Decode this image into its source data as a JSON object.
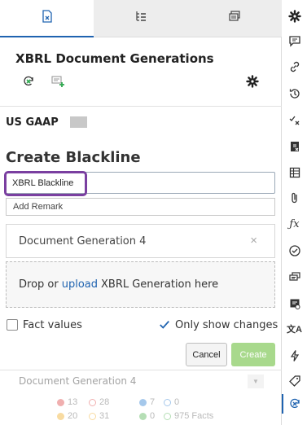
{
  "panel": {
    "tabs": [
      {
        "icon": "document-formula-icon",
        "active": true
      },
      {
        "icon": "tree-list-icon",
        "active": false
      },
      {
        "icon": "stacked-pages-icon",
        "active": false
      }
    ],
    "title": "XBRL Document Generations",
    "gaap_label": "US GAAP",
    "create_title": "Create Blackline",
    "name_input_value": "XBRL Blackline",
    "remark_placeholder": "Add Remark",
    "selected_generation": "Document Generation 4",
    "remove_symbol": "×",
    "drop": {
      "before": "Drop or",
      "link": "upload",
      "after": "XBRL Generation here"
    },
    "options": {
      "fact_values_label": "Fact values",
      "fact_values_checked": false,
      "only_changes_label": "Only show changes",
      "only_changes_checked": true
    },
    "buttons": {
      "cancel": "Cancel",
      "create": "Create"
    },
    "previous": {
      "name": "Document Generation 4",
      "stats": {
        "red_filled": "13",
        "red_outline": "28",
        "blue_filled": "7",
        "blue_outline": "0",
        "yellow_filled": "20",
        "yellow_outline": "31",
        "green_filled": "0",
        "facts": "975 Facts"
      }
    }
  },
  "colors": {
    "accent": "#1f63b0",
    "highlight": "#7a3fa0",
    "create_button": "#a8d98c",
    "red": "#e05050",
    "yellow": "#f0b030",
    "blue": "#3a86d4",
    "green": "#5cb85c"
  },
  "rail_icons": [
    "gear-icon",
    "comment-icon",
    "link-icon",
    "history-icon",
    "check-x-icon",
    "document-formula-icon",
    "table-icon",
    "paperclip-icon",
    "function-icon",
    "check-circle-icon",
    "chat-bubbles-icon",
    "document-check-icon",
    "translate-icon",
    "lightning-icon",
    "tag-icon",
    "xbrl-sync-icon"
  ]
}
